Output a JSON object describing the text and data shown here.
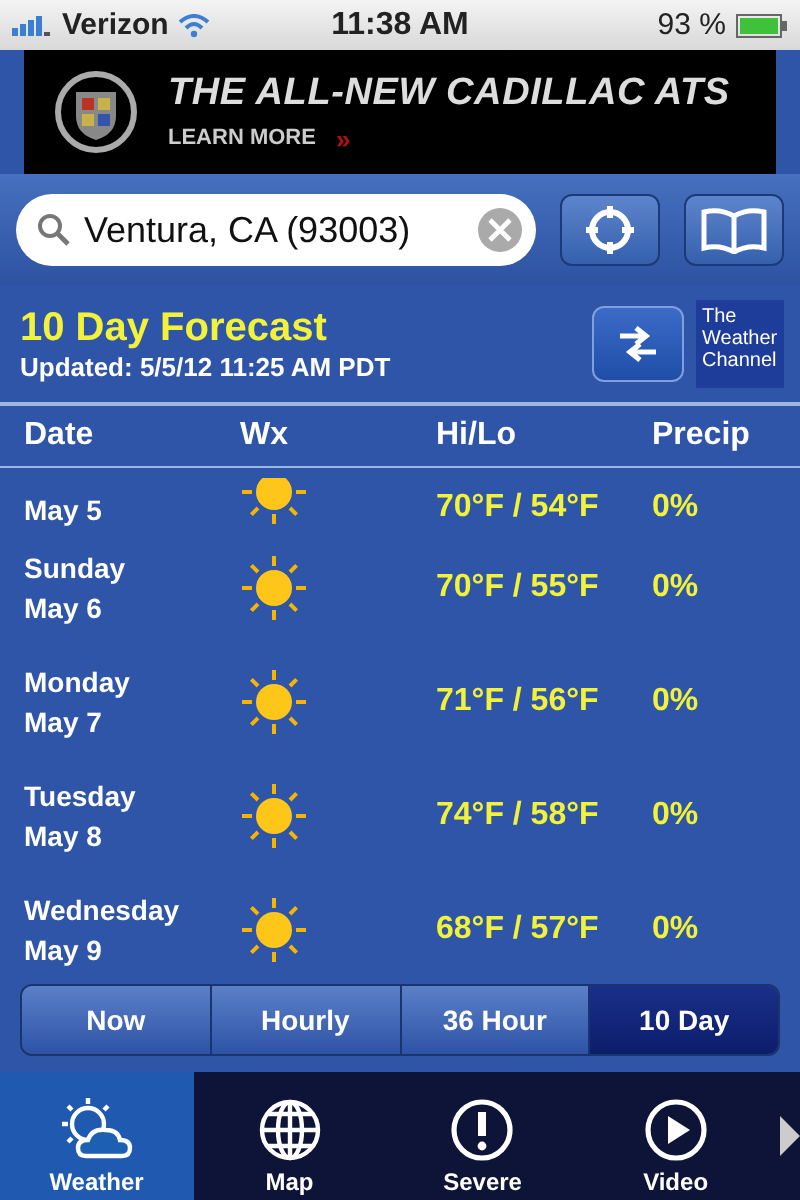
{
  "status_bar": {
    "carrier": "Verizon",
    "time": "11:38 AM",
    "battery": "93 %"
  },
  "ad": {
    "headline": "THE ALL-NEW CADILLAC ATS",
    "link": "LEARN MORE",
    "chevrons": "»"
  },
  "search": {
    "value": "Ventura, CA (93003)"
  },
  "header": {
    "title": "10 Day Forecast",
    "updated": "Updated: 5/5/12 11:25 AM PDT",
    "brand": "The Weather Channel"
  },
  "table": {
    "columns": [
      "Date",
      "Wx",
      "Hi/Lo",
      "Precip"
    ],
    "rows": [
      {
        "date": "May 5",
        "hilo": "70°F / 54°F",
        "precip": "0%"
      },
      {
        "day": "Sunday",
        "date": "May 6",
        "hilo": "70°F / 55°F",
        "precip": "0%"
      },
      {
        "day": "Monday",
        "date": "May 7",
        "hilo": "71°F / 56°F",
        "precip": "0%"
      },
      {
        "day": "Tuesday",
        "date": "May 8",
        "hilo": "74°F / 58°F",
        "precip": "0%"
      },
      {
        "day": "Wednesday",
        "date": "May 9",
        "hilo": "68°F / 57°F",
        "precip": "0%"
      }
    ]
  },
  "segments": [
    {
      "label": "Now",
      "selected": false
    },
    {
      "label": "Hourly",
      "selected": false
    },
    {
      "label": "36 Hour",
      "selected": false
    },
    {
      "label": "10 Day",
      "selected": true
    }
  ],
  "tab_bar": [
    {
      "kind": "weather",
      "label": "Weather",
      "selected": true
    },
    {
      "kind": "map",
      "label": "Map",
      "selected": false
    },
    {
      "kind": "severe",
      "label": "Severe",
      "selected": false
    },
    {
      "kind": "video",
      "label": "Video",
      "selected": false
    }
  ]
}
